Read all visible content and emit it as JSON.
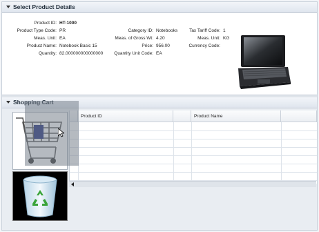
{
  "select_panel": {
    "title": "Select Product Details",
    "fields": {
      "product_id_label": "Product ID:",
      "product_id_value": "HT-1000",
      "product_type_label": "Product Type Code:",
      "product_type_value": "PR",
      "meas_unit_label": "Meas. Unit:",
      "meas_unit_value": "EA",
      "product_name_label": "Product Name:",
      "product_name_value": "Notebook Basic 15",
      "quantity_label": "Quantity:",
      "quantity_value": "82.000000000000000",
      "category_label": "Category ID:",
      "category_value": "Notebooks",
      "gross_wt_label": "Meas. of Gross Wt:",
      "gross_wt_value": "4.20",
      "price_label": "Price:",
      "price_value": "956.00",
      "qty_unit_label": "Quantity Unit Code:",
      "qty_unit_value": "EA",
      "tax_label": "Tax Tariff Code:",
      "tax_value": "1",
      "meas_unit2_label": "Meas. Unit:",
      "meas_unit2_value": "KG",
      "currency_label": "Currency Code:",
      "currency_value": ""
    }
  },
  "cart_panel": {
    "title": "Shopping Cart",
    "columns": [
      "Product ID",
      "Product Name"
    ]
  },
  "icons": {
    "laptop": "laptop-icon",
    "cart": "shopping-cart-icon",
    "trash": "recycle-bin-icon"
  }
}
